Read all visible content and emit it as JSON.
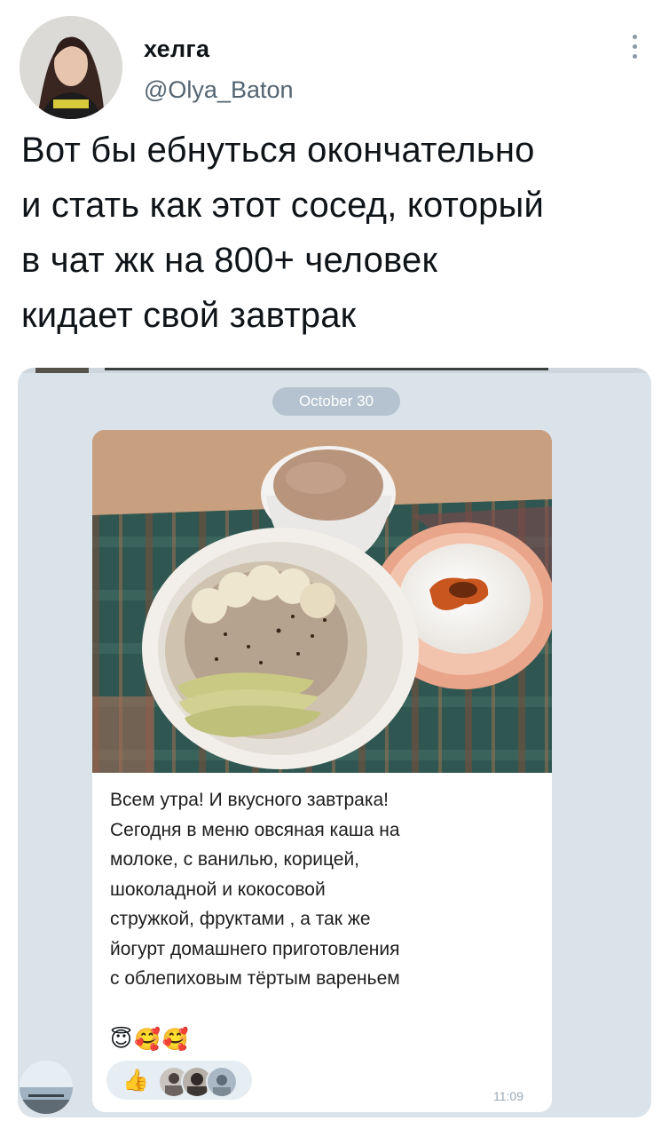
{
  "tweet": {
    "author_name": "хелга",
    "author_handle": "@Olya_Baton",
    "text_lines": [
      "Вот бы ебнуться окончательно",
      "и стать как этот сосед, который",
      "в чат жк на 800+ человек",
      "кидает свой завтрак"
    ]
  },
  "chat": {
    "date": "October 30",
    "caption_lines": [
      "Всем утра! И вкусного завтрака!",
      "Сегодня в меню овсяная каша на",
      "молоке, с ванилью, корицей,",
      "шоколадной и кокосовой",
      "стружкой, фруктами , а так же",
      "йогурт домашнего приготовления",
      "с облепиховым тёртым вареньем"
    ],
    "emojis": [
      "😇",
      "🥰",
      "🥰"
    ],
    "reaction_emoji": "👍",
    "time": "11:09"
  },
  "icons": {
    "more": "more-vertical-icon",
    "reaction": "thumbs-up-icon"
  },
  "colors": {
    "handle": "#536471",
    "chat_background": "#dbe3ea",
    "date_pill": "#b4c3cf",
    "time": "#9aa7b2"
  }
}
